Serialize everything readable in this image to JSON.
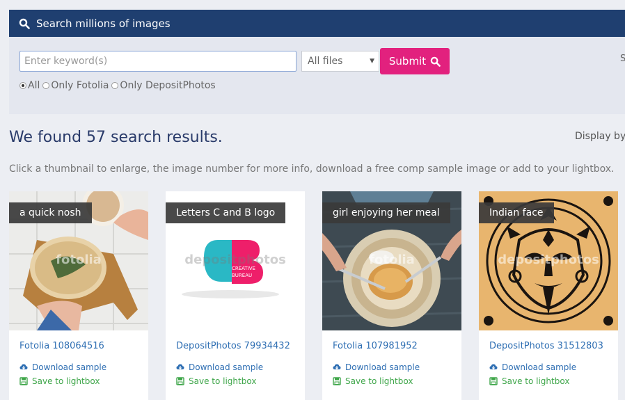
{
  "search": {
    "header_title": "Search millions of images",
    "placeholder": "Enter keyword(s)",
    "file_type_selected": "All files",
    "submit_label": "Submit",
    "sources": [
      {
        "label": "All",
        "checked": true
      },
      {
        "label": "Only Fotolia",
        "checked": false
      },
      {
        "label": "Only DepositPhotos",
        "checked": false
      }
    ],
    "side_text": "S"
  },
  "results": {
    "title": "We found 57 search results.",
    "display_by": "Display by",
    "instructions": "Click a thumbnail to enlarge, the image number for more info, download a free comp sample image or add to your lightbox."
  },
  "cards": [
    {
      "caption": "a quick nosh",
      "number": "Fotolia 108064516",
      "watermark": "fotolia",
      "download": "Download sample",
      "save": "Save to lightbox"
    },
    {
      "caption": "Letters C and B logo",
      "number": "DepositPhotos 79934432",
      "watermark": "depositphotos",
      "download": "Download sample",
      "save": "Save to lightbox",
      "logo_text_1": "CREATIVE",
      "logo_text_2": "BUREAU"
    },
    {
      "caption": "girl enjoying her meal",
      "number": "Fotolia 107981952",
      "watermark": "fotolia",
      "download": "Download sample",
      "save": "Save to lightbox"
    },
    {
      "caption": "Indian face",
      "number": "DepositPhotos 31512803",
      "watermark": "depositphotos",
      "download": "Download sample",
      "save": "Save to lightbox"
    }
  ],
  "colors": {
    "header_bg": "#1f3f70",
    "submit_bg": "#e2217e",
    "link_blue": "#2f6fb3",
    "save_green": "#3fa64a"
  }
}
